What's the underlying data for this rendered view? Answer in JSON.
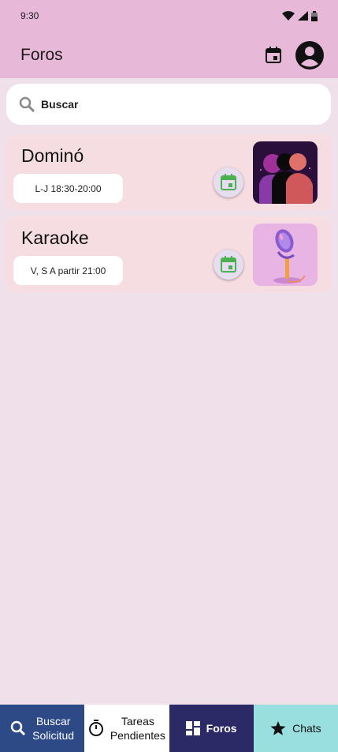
{
  "status": {
    "time": "9:30"
  },
  "header": {
    "title": "Foros"
  },
  "search": {
    "text": "Buscar"
  },
  "forums": [
    {
      "title": "Dominó",
      "schedule": "L-J 18:30-20:00"
    },
    {
      "title": "Karaoke",
      "schedule": "V, S A partir 21:00"
    }
  ],
  "bottom_nav": [
    {
      "label_line1": "Buscar",
      "label_line2": "Solicitud"
    },
    {
      "label_line1": "Tareas",
      "label_line2": "Pendientes"
    },
    {
      "label_line1": "Foros"
    },
    {
      "label_line1": "Chats"
    }
  ],
  "colors": {
    "app_bar": "#e8b8d8",
    "background": "#efe0ea",
    "card": "#f6dde2",
    "calendar_green": "#4caf50",
    "nav_active": "#2c2a66"
  }
}
